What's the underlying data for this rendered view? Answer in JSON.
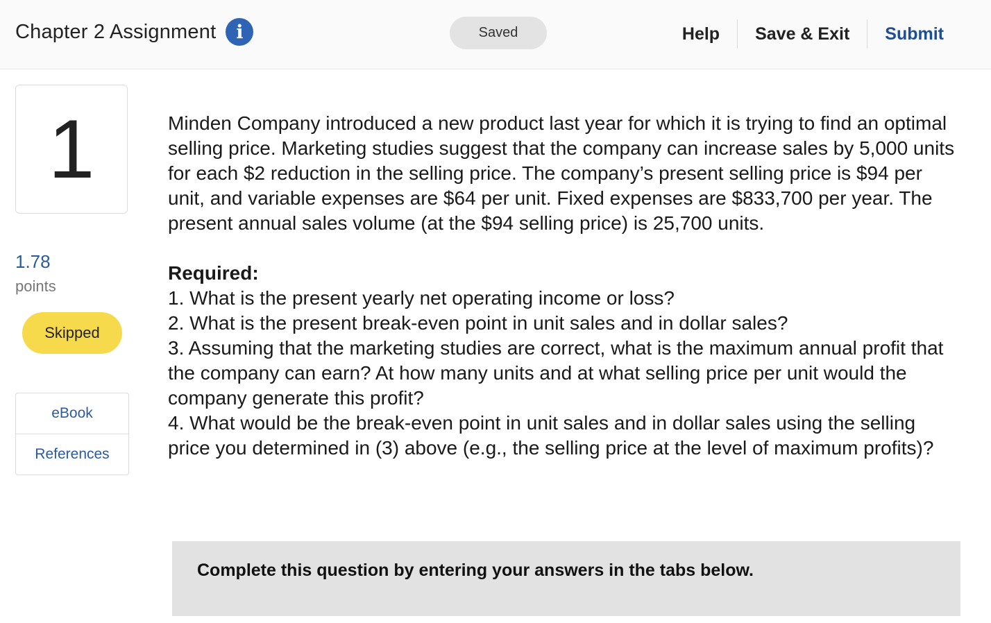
{
  "header": {
    "title": "Chapter 2 Assignment",
    "info_icon": "info-icon",
    "saved_label": "Saved",
    "help_label": "Help",
    "save_exit_label": "Save & Exit",
    "submit_label": "Submit"
  },
  "sidebar": {
    "question_number": "1",
    "points_value": "1.78",
    "points_label": "points",
    "status_label": "Skipped",
    "resources": [
      {
        "label": "eBook"
      },
      {
        "label": "References"
      }
    ]
  },
  "question": {
    "paragraph": "Minden Company introduced a new product last year for which it is trying to find an optimal selling price. Marketing studies suggest that the company can increase sales by 5,000 units for each $2 reduction in the selling price. The company’s present selling price is $94 per unit, and variable expenses are $64 per unit. Fixed expenses are $833,700 per year. The present annual sales volume (at the $94 selling price) is 25,700 units.",
    "required_title": "Required:",
    "requirements": [
      "1. What is the present yearly net operating income or loss?",
      "2. What is the present break-even point in unit sales and in dollar sales?",
      "3. Assuming that the marketing studies are correct, what is the maximum annual profit that the company can earn? At how many units and at what selling price per unit would the company generate this profit?",
      "4. What would be the break-even point in unit sales and in dollar sales using the selling price you determined in (3) above (e.g., the selling price at the level of maximum profits)?"
    ],
    "instruction": "Complete this question by entering your answers in the tabs below."
  },
  "colors": {
    "accent_blue": "#2f64b5",
    "link_blue": "#2b5aa0",
    "submit_blue": "#1f4f93",
    "skipped_yellow": "#f7d94c",
    "saved_gray": "#e3e3e3",
    "instruction_bg": "#e2e2e2"
  }
}
